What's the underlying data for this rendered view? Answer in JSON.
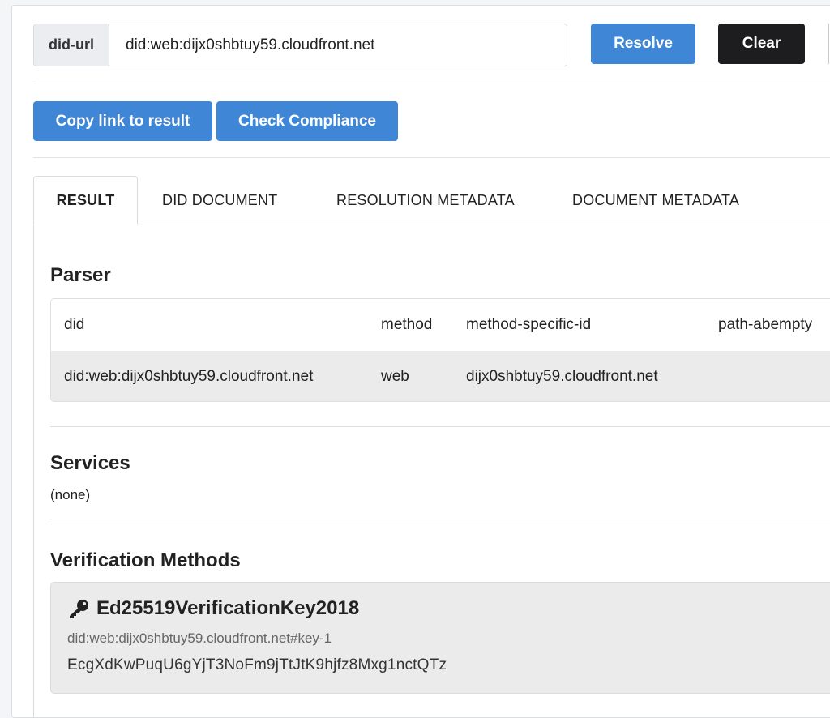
{
  "search": {
    "addon_label": "did-url",
    "value": "did:web:dijx0shbtuy59.cloudfront.net",
    "resolve_label": "Resolve",
    "clear_label": "Clear"
  },
  "actions": {
    "copy_label": "Copy link to result",
    "compliance_label": "Check Compliance"
  },
  "tabs": [
    {
      "label": "RESULT",
      "active": true
    },
    {
      "label": "DID DOCUMENT",
      "active": false
    },
    {
      "label": "RESOLUTION METADATA",
      "active": false
    },
    {
      "label": "DOCUMENT METADATA",
      "active": false
    }
  ],
  "parser": {
    "title": "Parser",
    "headers": [
      "did",
      "method",
      "method-specific-id",
      "path-abempty"
    ],
    "row": [
      "did:web:dijx0shbtuy59.cloudfront.net",
      "web",
      "dijx0shbtuy59.cloudfront.net",
      ""
    ]
  },
  "services": {
    "title": "Services",
    "empty_text": "(none)"
  },
  "verification": {
    "title": "Verification Methods",
    "items": [
      {
        "icon": "key-icon",
        "type": "Ed25519VerificationKey2018",
        "id": "did:web:dijx0shbtuy59.cloudfront.net#key-1",
        "key": "EcgXdKwPuqU6gYjT3NoFm9jTtJtK9hjfz8Mxg1nctQTz"
      }
    ]
  },
  "colors": {
    "primary": "#3f87d6",
    "dark": "#1d1d1f",
    "row_bg": "#ebebeb"
  }
}
